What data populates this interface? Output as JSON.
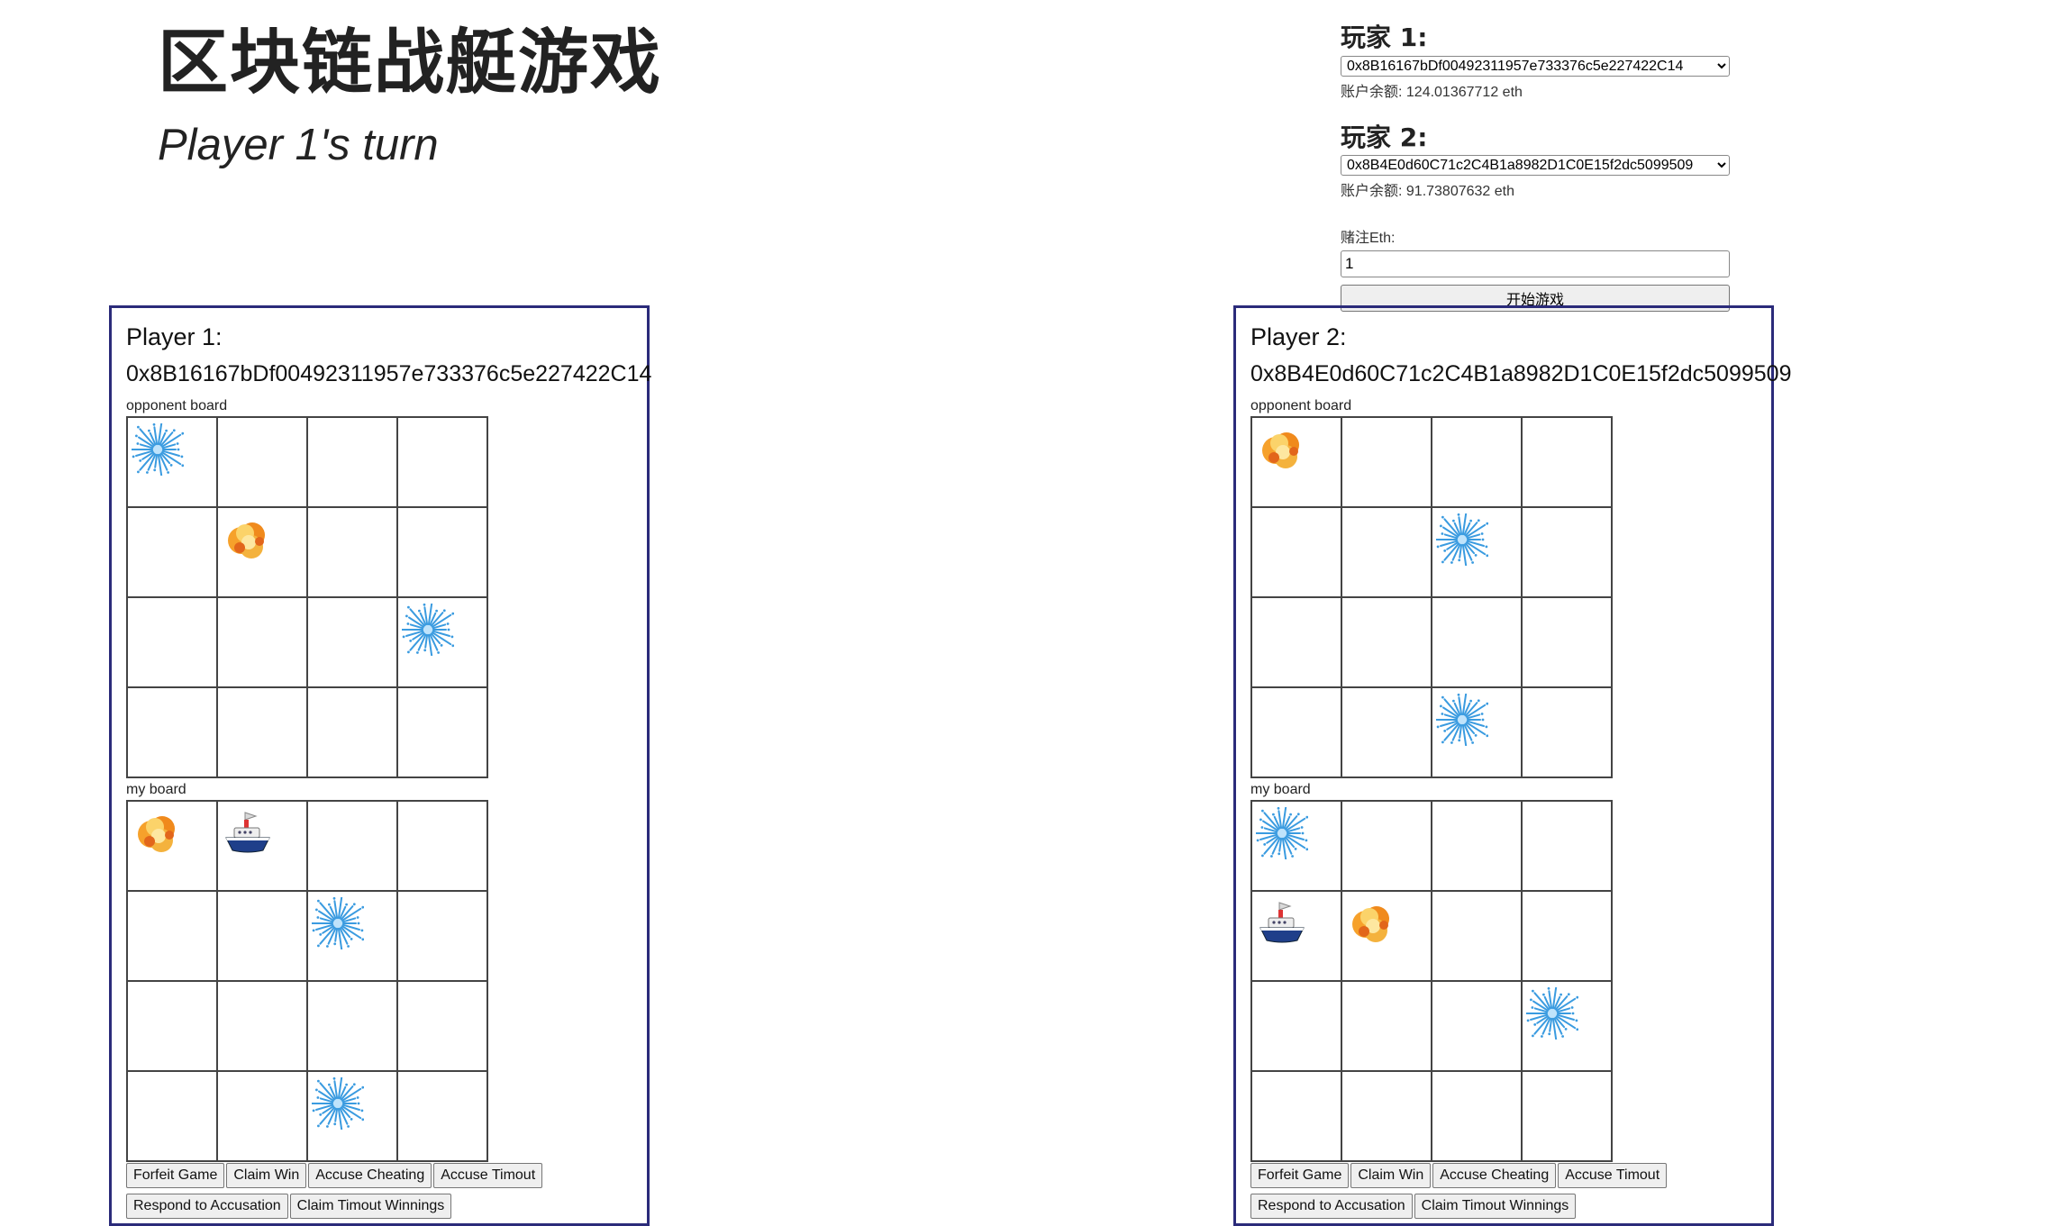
{
  "title": "区块链战艇游戏",
  "turn_text": "Player 1's turn",
  "setup": {
    "player1_label": "玩家 1:",
    "player1_account": "0x8B16167bDf00492311957e733376c5e227422C14",
    "player1_balance": "账户余额: 124.01367712 eth",
    "player2_label": "玩家 2:",
    "player2_account": "0x8B4E0d60C71c2C4B1a8982D1C0E15f2dc5099509",
    "player2_balance": "账户余额: 91.73807632 eth",
    "bet_label": "赌注Eth:",
    "bet_value": "1",
    "start_button": "开始游戏"
  },
  "players": [
    {
      "title": "Player 1:",
      "address": "0x8B16167bDf00492311957e733376c5e227422C14",
      "opponent_board_label": "opponent board",
      "my_board_label": "my board",
      "opponent_board": [
        [
          "splash",
          "",
          "",
          ""
        ],
        [
          "",
          "explosion",
          "",
          ""
        ],
        [
          "",
          "",
          "",
          "splash"
        ],
        [
          "",
          "",
          "",
          ""
        ]
      ],
      "my_board": [
        [
          "explosion",
          "ship",
          "",
          ""
        ],
        [
          "",
          "",
          "splash",
          ""
        ],
        [
          "",
          "",
          "",
          ""
        ],
        [
          "",
          "",
          "splash",
          ""
        ]
      ]
    },
    {
      "title": "Player 2:",
      "address": "0x8B4E0d60C71c2C4B1a8982D1C0E15f2dc5099509",
      "opponent_board_label": "opponent board",
      "my_board_label": "my board",
      "opponent_board": [
        [
          "explosion",
          "",
          "",
          ""
        ],
        [
          "",
          "",
          "splash",
          ""
        ],
        [
          "",
          "",
          "",
          ""
        ],
        [
          "",
          "",
          "splash",
          ""
        ]
      ],
      "my_board": [
        [
          "splash",
          "",
          "",
          ""
        ],
        [
          "ship",
          "explosion",
          "",
          ""
        ],
        [
          "",
          "",
          "",
          "splash"
        ],
        [
          "",
          "",
          "",
          ""
        ]
      ]
    }
  ],
  "actions": {
    "forfeit": "Forfeit Game",
    "claim_win": "Claim Win",
    "accuse_cheating": "Accuse Cheating",
    "accuse_timeout": "Accuse Timout",
    "respond": "Respond to Accusation",
    "claim_timeout": "Claim Timout Winnings"
  },
  "colors": {
    "panel_border": "#2b2b7a",
    "splash": "#3a9be0",
    "explosion": "#f08a1c",
    "ship_hull": "#1f3f8a"
  }
}
